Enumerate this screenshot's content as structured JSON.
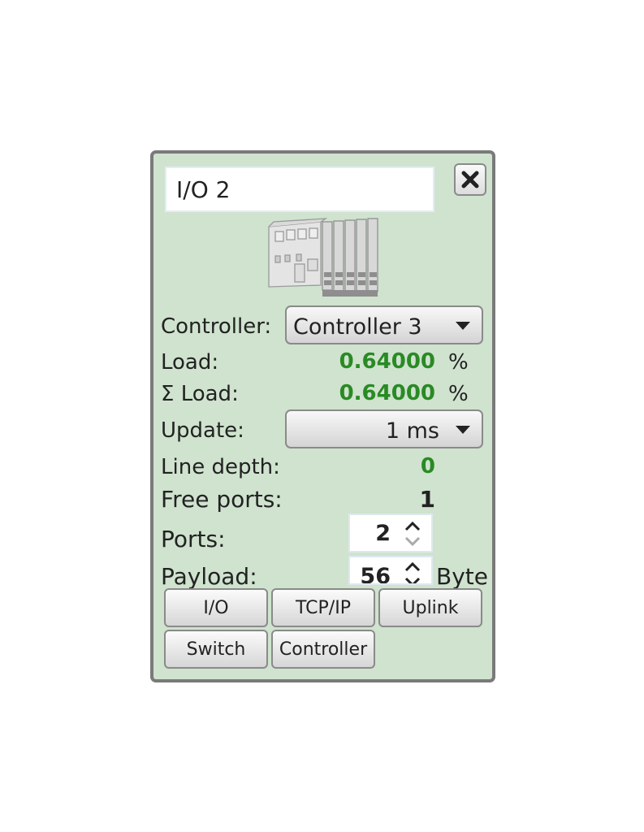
{
  "panel": {
    "name_value": "I/O 2",
    "controller_label": "Controller:",
    "controller_value": "Controller 3",
    "load_label": "Load:",
    "load_value": "0.64000",
    "load_unit": "%",
    "sum_load_label": "Σ Load:",
    "sum_load_value": "0.64000",
    "sum_load_unit": "%",
    "update_label": "Update:",
    "update_value": "1 ms",
    "line_depth_label": "Line depth:",
    "line_depth_value": "0",
    "free_ports_label": "Free ports:",
    "free_ports_value": "1",
    "ports_label": "Ports:",
    "ports_value": "2",
    "payload_label": "Payload:",
    "payload_value": "56",
    "payload_unit": "Byte"
  },
  "buttons": {
    "io": "I/O",
    "tcpip": "TCP/IP",
    "uplink": "Uplink",
    "switch": "Switch",
    "controller": "Controller"
  },
  "icons": {
    "close": "close-icon",
    "device": "io-module-icon",
    "dropdown": "chevron-down-icon",
    "spinner": "spinner-arrows-icon"
  },
  "colors": {
    "panel_bg": "#cfe3cf",
    "panel_border": "#7a7a7a",
    "value_green": "#2a8a24"
  }
}
